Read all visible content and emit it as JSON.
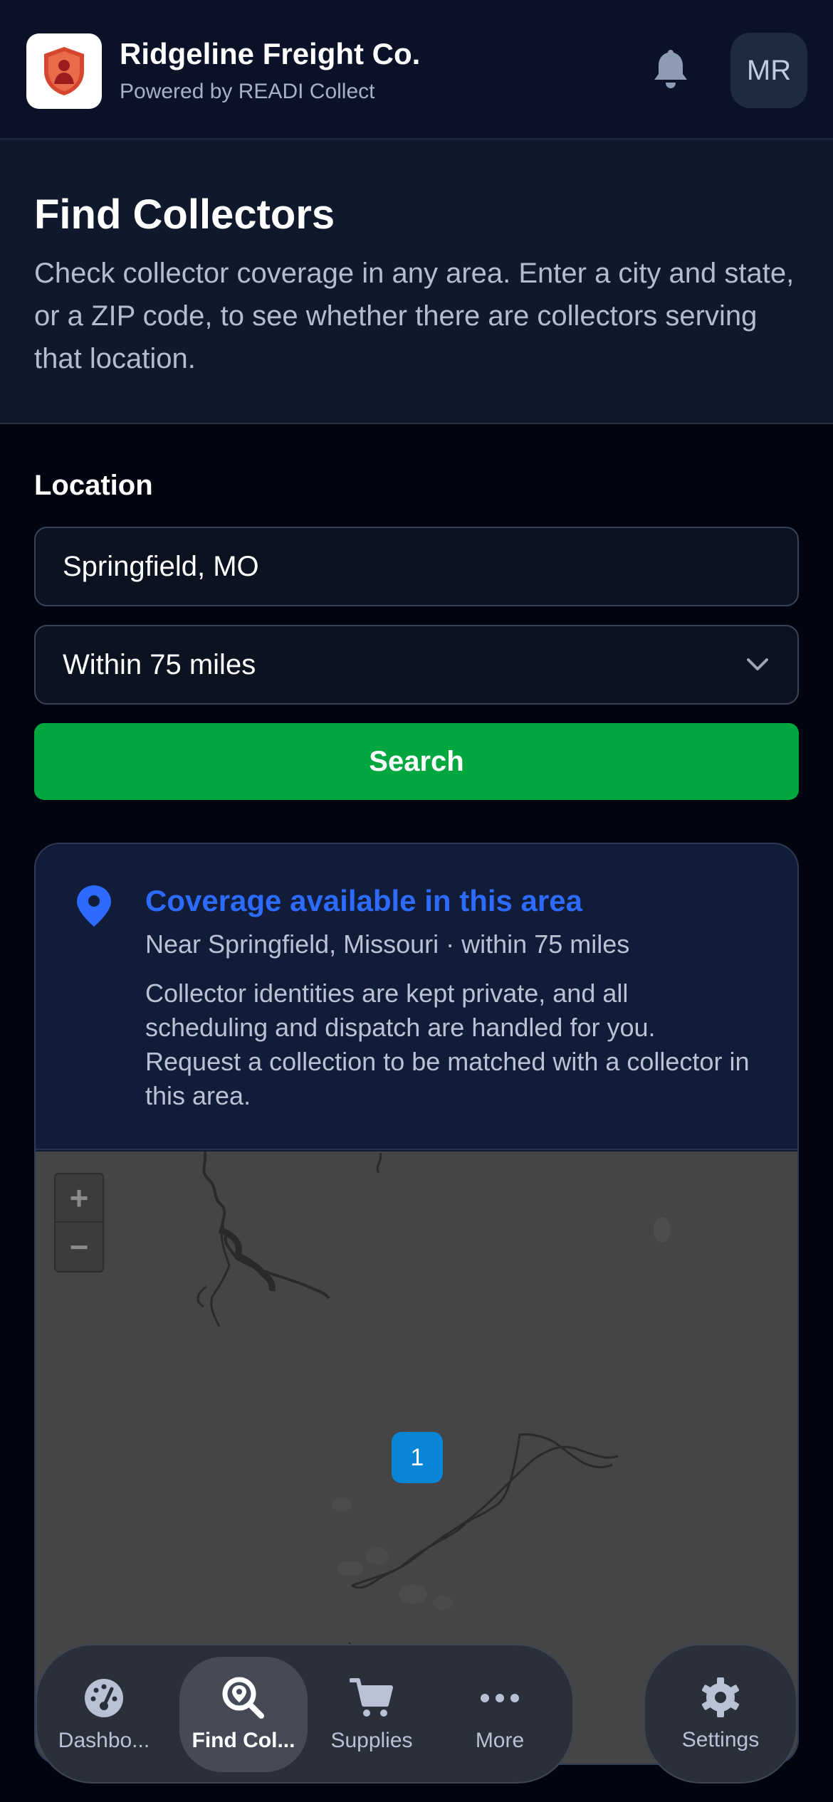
{
  "header": {
    "brand_title": "Ridgeline Freight Co.",
    "brand_subtitle": "Powered by READI Collect",
    "logo_icon": "shield-person-logo",
    "notification_icon": "bell-icon",
    "avatar_initials": "MR"
  },
  "intro": {
    "title": "Find Collectors",
    "description": "Check collector coverage in any area. Enter a city and state, or a ZIP code, to see whether there are collectors serving that location."
  },
  "form": {
    "location_label": "Location",
    "location_value": "Springfield, MO",
    "radius_value": "Within 75 miles",
    "search_label": "Search"
  },
  "result": {
    "icon": "map-pin-icon",
    "title": "Coverage available in this area",
    "subtitle": "Near Springfield, Missouri · within 75 miles",
    "body": "Collector identities are kept private, and all scheduling and dispatch are handled for you. Request a collection to be matched with a collector in this area."
  },
  "map": {
    "zoom_in": "+",
    "zoom_out": "−",
    "cluster_count": "1"
  },
  "nav": {
    "items": [
      {
        "label": "Dashbo...",
        "icon": "dashboard-gauge-icon"
      },
      {
        "label": "Find Col...",
        "icon": "search-pin-icon",
        "active": true
      },
      {
        "label": "Supplies",
        "icon": "cart-icon"
      },
      {
        "label": "More",
        "icon": "more-dots-icon"
      }
    ],
    "settings_label": "Settings",
    "settings_icon": "gear-icon"
  },
  "colors": {
    "accent_green": "#00a63e",
    "coverage_blue": "#2d6bff",
    "cluster_blue": "#0a86d6",
    "background": "#02050f"
  }
}
